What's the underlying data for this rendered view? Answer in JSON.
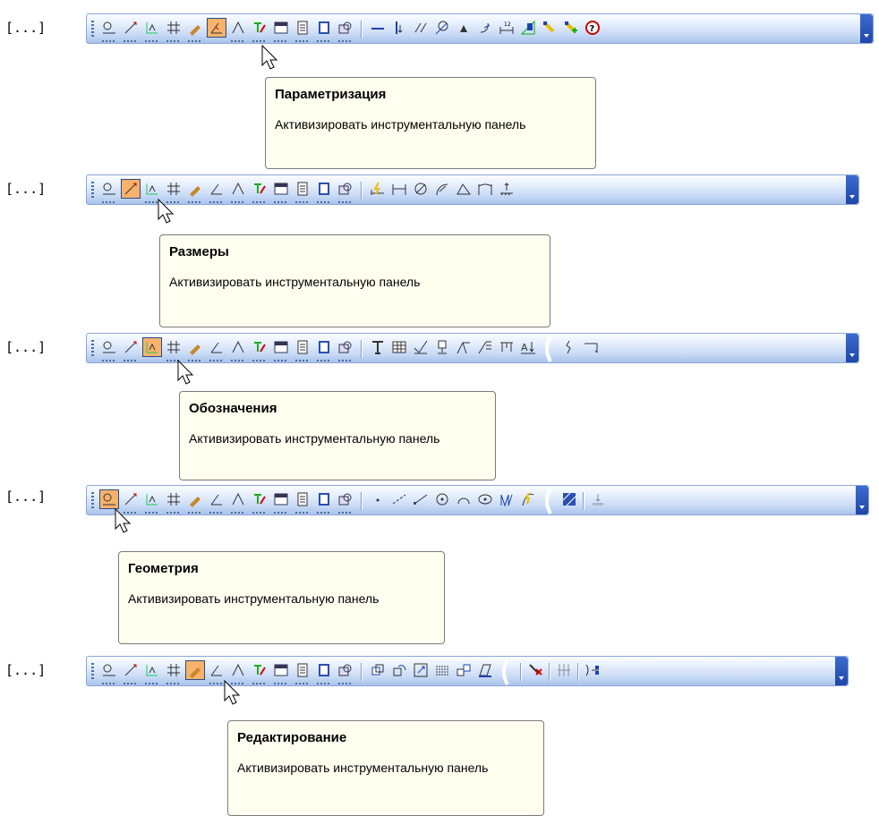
{
  "ellipsis_label": "[...]",
  "panel_tooltips": [
    {
      "title": "Параметризация",
      "body": "Активизировать инструментальную панель"
    },
    {
      "title": "Размеры",
      "body": "Активизировать инструментальную панель"
    },
    {
      "title": "Обозначения",
      "body": "Активизировать инструментальную панель"
    },
    {
      "title": "Геометрия",
      "body": "Активизировать инструментальную панель"
    },
    {
      "title": "Редактирование",
      "body": "Активизировать инструментальную панель"
    }
  ],
  "compact_panel_buttons": [
    "geometry-panel-icon",
    "dimensions-panel-icon",
    "designations-panel-icon",
    "grid-panel-icon",
    "editing-panel-icon",
    "parametrization-panel-icon",
    "measure-panel-icon",
    "select-panel-icon",
    "views-panel-icon",
    "spec-panel-icon",
    "reports-panel-icon",
    "inserts-panel-icon"
  ],
  "colors": {
    "toolbar_top": "#fbfdff",
    "toolbar_bottom": "#a9c3ec",
    "active_button": "#f7b26b",
    "tooltip_bg": "#fffff0"
  }
}
